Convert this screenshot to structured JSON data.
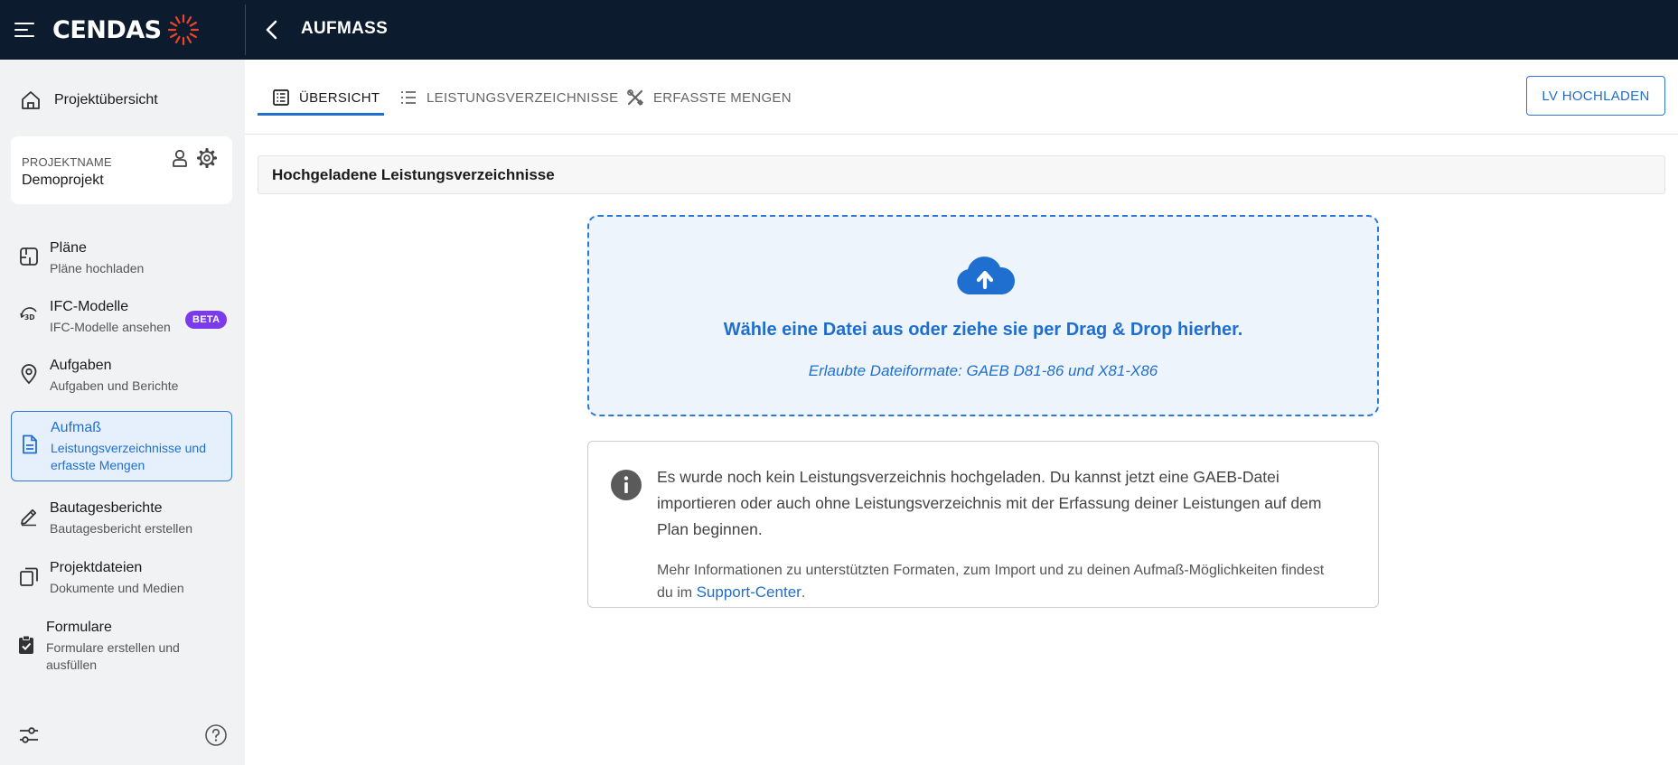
{
  "header": {
    "logo_text": "CENDAS",
    "page_title": "AUFMASS"
  },
  "sidebar": {
    "overview_label": "Projektübersicht",
    "project": {
      "caption": "PROJEKTNAME",
      "name": "Demoprojekt"
    },
    "items": [
      {
        "title": "Pläne",
        "subtitle": "Pläne hochladen"
      },
      {
        "title": "IFC-Modelle",
        "subtitle": "IFC-Modelle ansehen",
        "badge": "BETA"
      },
      {
        "title": "Aufgaben",
        "subtitle": "Aufgaben und Berichte"
      },
      {
        "title": "Aufmaß",
        "subtitle": "Leistungsverzeichnisse und erfasste Mengen",
        "active": true
      },
      {
        "title": "Bautagesberichte",
        "subtitle": "Bautagesbericht erstellen"
      },
      {
        "title": "Projektdateien",
        "subtitle": "Dokumente und Medien"
      },
      {
        "title": "Formulare",
        "subtitle": "Formulare erstellen und ausfüllen"
      }
    ]
  },
  "tabs": [
    {
      "label": "ÜBERSICHT",
      "active": true
    },
    {
      "label": "LEISTUNGSVERZEICHNISSE"
    },
    {
      "label": "ERFASSTE MENGEN"
    }
  ],
  "toolbar": {
    "upload_label": "LV HOCHLADEN"
  },
  "section": {
    "title": "Hochgeladene Leistungsverzeichnisse"
  },
  "dropzone": {
    "primary": "Wähle eine Datei aus oder ziehe sie per Drag & Drop hierher.",
    "secondary": "Erlaubte Dateiformate: GAEB D81-86 und X81-X86"
  },
  "info": {
    "message": "Es wurde noch kein Leistungsverzeichnis hochgeladen. Du kannst jetzt eine GAEB-Datei importieren oder auch ohne Leistungsverzeichnis mit der Erfassung deiner Leistungen auf dem Plan beginnen.",
    "more_prefix": "Mehr Informationen zu unterstützten Formaten, zum Import und zu deinen Aufmaß-Möglichkeiten findest du im ",
    "link_label": "Support-Center",
    "more_suffix": "."
  },
  "colors": {
    "topbar_bg": "#0d1b2e",
    "accent": "#1f6fd1",
    "logo_accent": "#e8452c",
    "beta_badge": "#7c3aed",
    "sidebar_bg": "#f1f2f4"
  },
  "icons": {
    "menu": "hamburger-icon",
    "back": "chevron-left-icon",
    "overview": "home-icon",
    "user": "user-icon",
    "settings": "gear-icon",
    "plans": "floorplan-icon",
    "ifc": "rotate-3d-icon",
    "tasks": "location-pin-icon",
    "measurement": "document-icon",
    "reports": "pencil-icon",
    "files": "copy-icon",
    "forms": "clipboard-check-icon",
    "filter": "sliders-icon",
    "help": "help-icon",
    "upload": "cloud-upload-icon",
    "info": "info-icon"
  }
}
